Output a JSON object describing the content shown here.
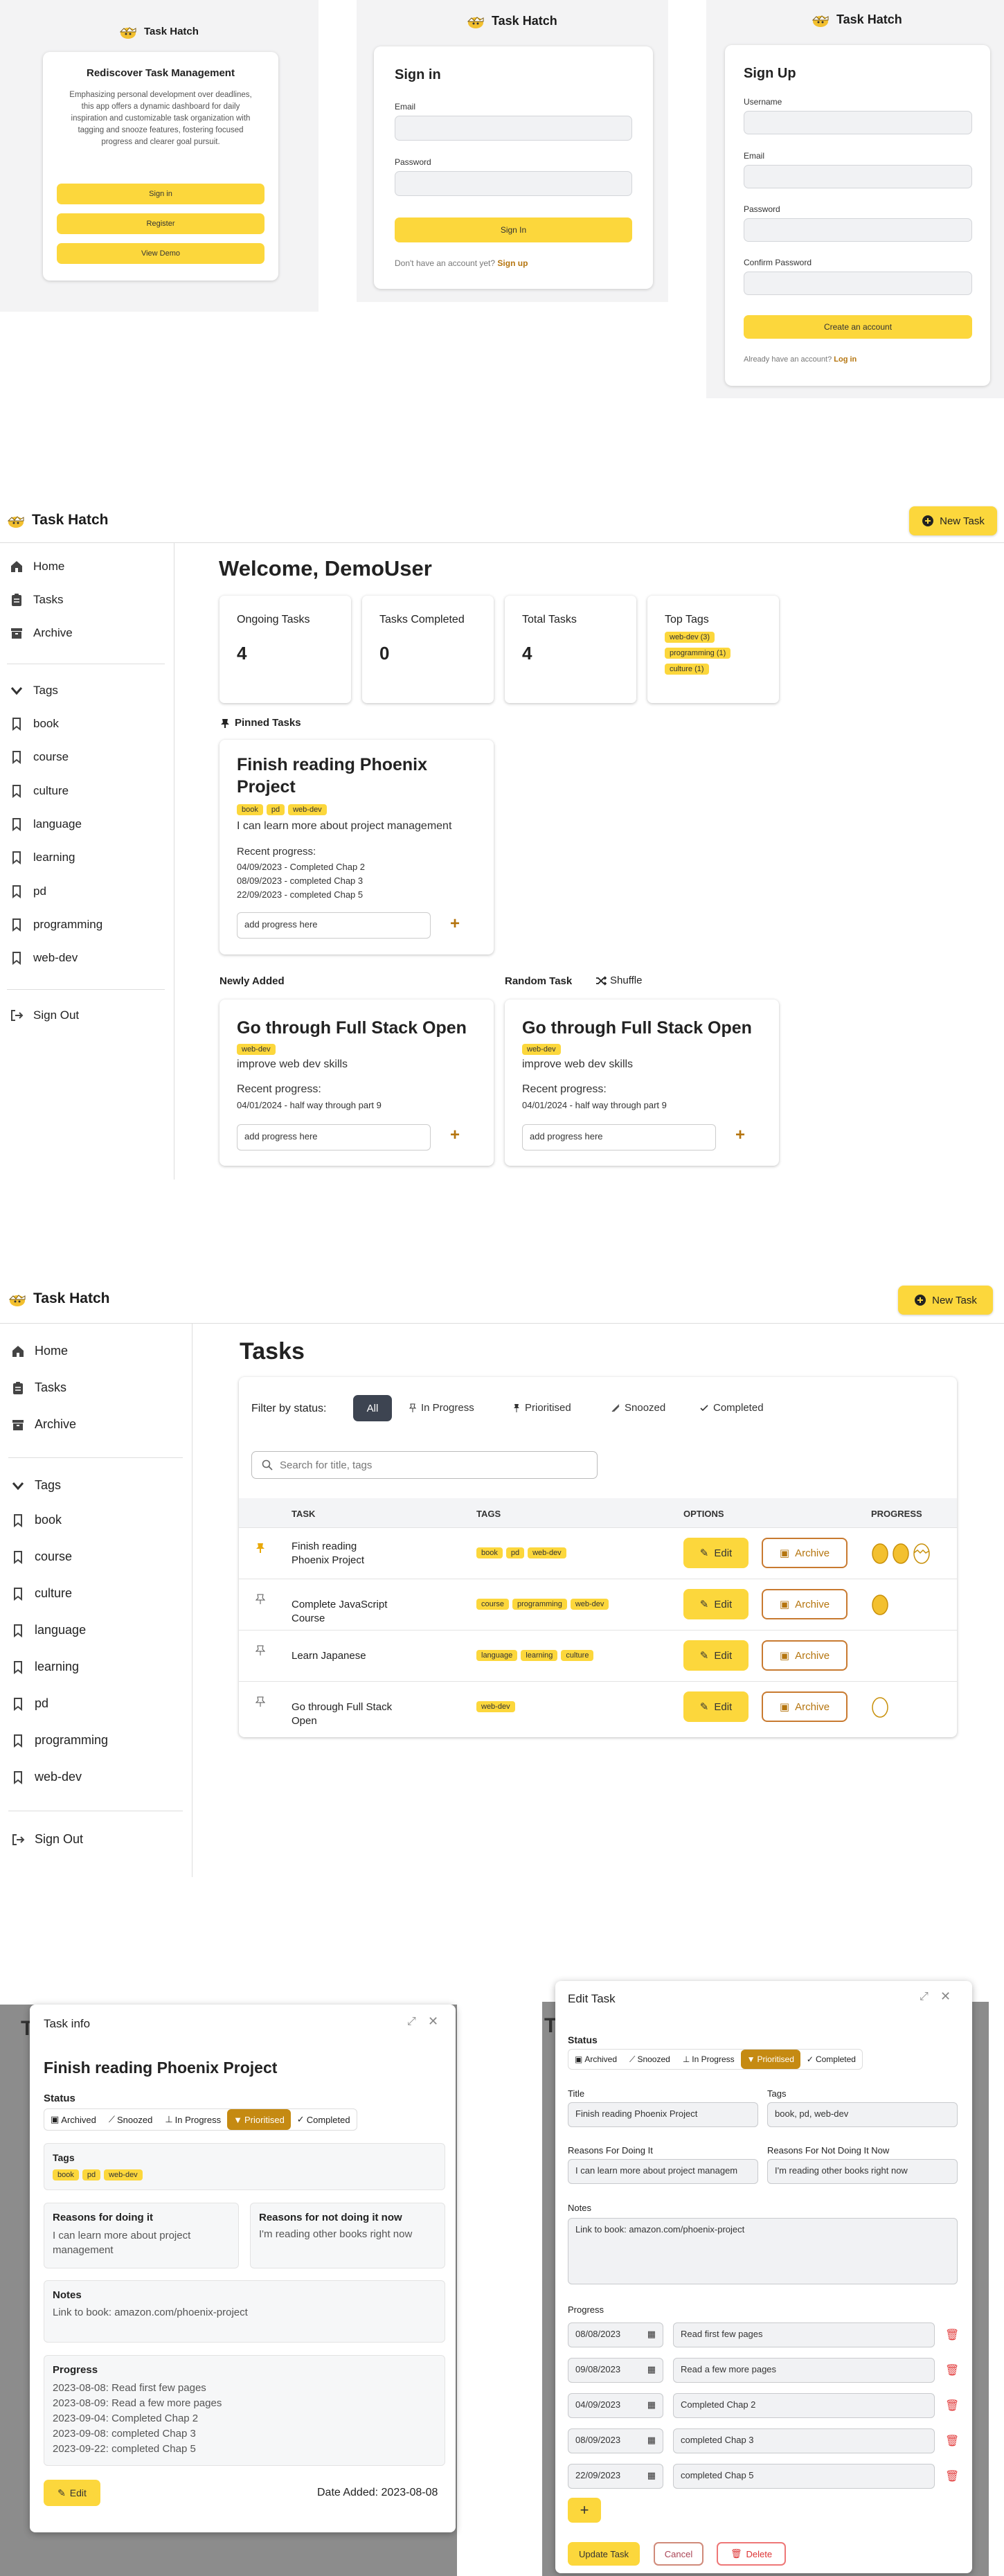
{
  "app": {
    "name": "Task Hatch"
  },
  "landing": {
    "heading": "Rediscover Task Management",
    "description": "Emphasizing personal development over deadlines, this app offers a dynamic dashboard for daily inspiration and customizable task organization with tagging and snooze features, fostering focused progress and clearer goal pursuit.",
    "buttons": [
      "Sign in",
      "Register",
      "View Demo"
    ]
  },
  "signin": {
    "heading": "Sign in",
    "email_label": "Email",
    "password_label": "Password",
    "submit": "Sign In",
    "footer_text": "Don't have an account yet?",
    "footer_link": "Sign up"
  },
  "signup": {
    "heading": "Sign Up",
    "username_label": "Username",
    "email_label": "Email",
    "password_label": "Password",
    "confirm_label": "Confirm Password",
    "submit": "Create an account",
    "footer_text": "Already have an account?",
    "footer_link": "Log in"
  },
  "sidebar": {
    "home": "Home",
    "tasks": "Tasks",
    "archive": "Archive",
    "tags_header": "Tags",
    "tags": [
      "book",
      "course",
      "culture",
      "language",
      "learning",
      "pd",
      "programming",
      "web-dev"
    ],
    "signout": "Sign Out"
  },
  "header": {
    "new_task": "New Task"
  },
  "dashboard": {
    "welcome": "Welcome, DemoUser",
    "stats": [
      {
        "title": "Ongoing Tasks",
        "value": "4"
      },
      {
        "title": "Tasks Completed",
        "value": "0"
      },
      {
        "title": "Total Tasks",
        "value": "4"
      }
    ],
    "top_tags_title": "Top Tags",
    "top_tags": [
      "web-dev (3)",
      "programming (1)",
      "culture (1)"
    ],
    "pinned_title": "Pinned Tasks",
    "pinned": {
      "title": "Finish reading Phoenix Project",
      "tags": [
        "book",
        "pd",
        "web-dev"
      ],
      "description": "I can learn more about project management",
      "progress_label": "Recent progress:",
      "progress": [
        "04/09/2023 - Completed Chap 2",
        "08/09/2023 - completed Chap 3",
        "22/09/2023 - completed Chap 5"
      ],
      "input_placeholder": "add progress here"
    },
    "newly_added_title": "Newly Added",
    "random_title": "Random Task",
    "shuffle": "Shuffle",
    "newly": {
      "title": "Go through Full Stack Open",
      "tags": [
        "web-dev"
      ],
      "description": "improve web dev skills",
      "progress_label": "Recent progress:",
      "progress": [
        "04/01/2024 - half way through part 9"
      ],
      "input_placeholder": "add progress here"
    }
  },
  "tasks_page": {
    "title": "Tasks",
    "filter_label": "Filter by status:",
    "filters": [
      "All",
      "In Progress",
      "Prioritised",
      "Snoozed",
      "Completed"
    ],
    "search_placeholder": "Search for title, tags",
    "columns": [
      "TASK",
      "TAGS",
      "OPTIONS",
      "PROGRESS"
    ],
    "edit": "Edit",
    "archive": "Archive",
    "rows": [
      {
        "title": "Finish reading Phoenix Project",
        "tags": [
          "book",
          "pd",
          "web-dev"
        ],
        "pinned": true,
        "eggs": 3
      },
      {
        "title": "Complete JavaScript Course",
        "tags": [
          "course",
          "programming",
          "web-dev"
        ],
        "pinned": false,
        "eggs": 1
      },
      {
        "title": "Learn Japanese",
        "tags": [
          "language",
          "learning",
          "culture"
        ],
        "pinned": false,
        "eggs": 0
      },
      {
        "title": "Go through Full Stack Open",
        "tags": [
          "web-dev"
        ],
        "pinned": false,
        "eggs": 1
      }
    ]
  },
  "task_info": {
    "header": "Task info",
    "title": "Finish reading Phoenix Project",
    "status_label": "Status",
    "statuses": [
      "Archived",
      "Snoozed",
      "In Progress",
      "Prioritised",
      "Completed"
    ],
    "tags_label": "Tags",
    "tags": [
      "book",
      "pd",
      "web-dev"
    ],
    "reasons_doing_label": "Reasons for doing it",
    "reasons_doing": "I can learn more about project management",
    "reasons_not_label": "Reasons for not doing it now",
    "reasons_not": "I'm reading other books right now",
    "notes_label": "Notes",
    "notes": "Link to book: amazon.com/phoenix-project",
    "progress_label": "Progress",
    "progress": [
      "2023-08-08: Read first few pages",
      "2023-08-09: Read a few more pages",
      "2023-09-04: Completed Chap 2",
      "2023-09-08: completed Chap 3",
      "2023-09-22: completed Chap 5"
    ],
    "edit": "Edit",
    "date_added": "Date Added: 2023-08-08"
  },
  "edit_task": {
    "header": "Edit Task",
    "status_label": "Status",
    "title_label": "Title",
    "title_value": "Finish reading Phoenix Project",
    "tags_label": "Tags",
    "tags_value": "book, pd, web-dev",
    "reasons_doing_label": "Reasons For Doing It",
    "reasons_doing": "I can learn more about project managem",
    "reasons_not_label": "Reasons For Not Doing It Now",
    "reasons_not": "I'm reading other books right now",
    "notes_label": "Notes",
    "notes": "Link to book: amazon.com/phoenix-project",
    "progress_label": "Progress",
    "progress": [
      {
        "date": "08/08/2023",
        "text": "Read first few pages"
      },
      {
        "date": "09/08/2023",
        "text": "Read a few more pages"
      },
      {
        "date": "04/09/2023",
        "text": "Completed Chap 2"
      },
      {
        "date": "08/09/2023",
        "text": "completed Chap 3"
      },
      {
        "date": "22/09/2023",
        "text": "completed Chap 5"
      }
    ],
    "update": "Update Task",
    "cancel": "Cancel",
    "delete": "Delete"
  },
  "colors": {
    "accent": "#fcd73c",
    "brown": "#b5750f",
    "prioritised": "#c58a12"
  }
}
